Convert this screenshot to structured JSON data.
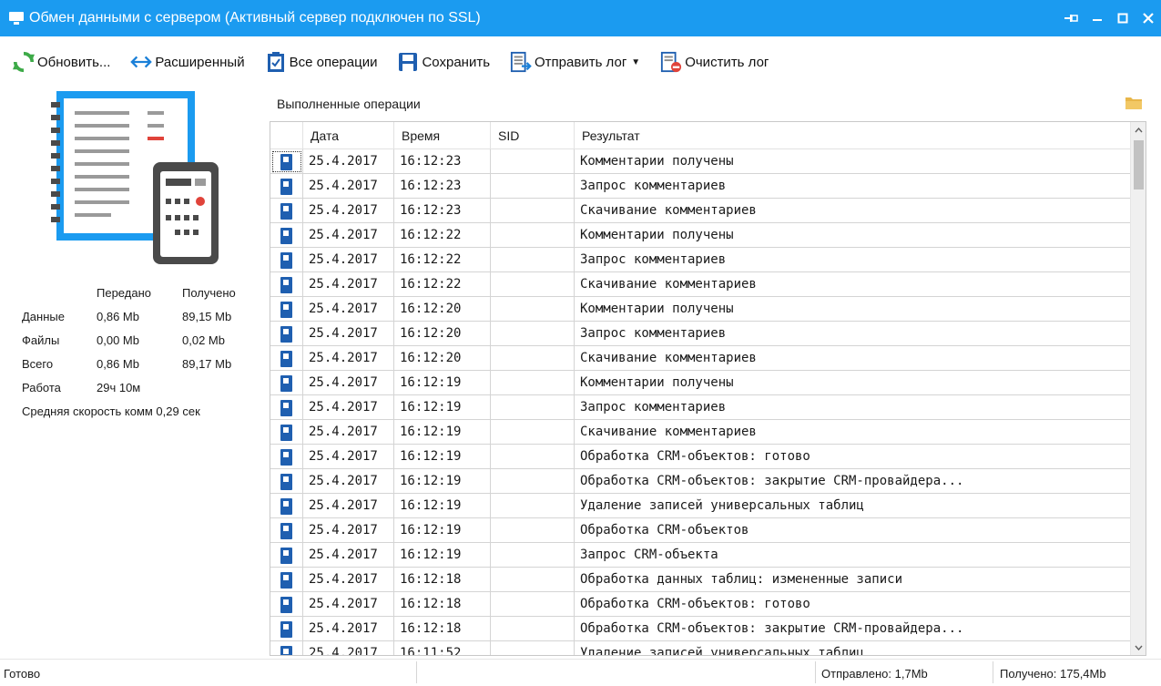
{
  "window": {
    "title": "Обмен данными с сервером (Активный сервер подключен по SSL)",
    "accent_color": "#1b9bf0"
  },
  "toolbar": {
    "refresh": {
      "label": "Обновить...",
      "icon": "refresh-icon"
    },
    "extended": {
      "label": "Расширенный",
      "icon": "double-arrow-icon"
    },
    "all_ops": {
      "label": "Все операции",
      "icon": "clipboard-check-icon"
    },
    "save": {
      "label": "Сохранить",
      "icon": "save-icon"
    },
    "send_log": {
      "label": "Отправить лог",
      "icon": "send-log-icon"
    },
    "clear_log": {
      "label": "Очистить лог",
      "icon": "clear-log-icon"
    }
  },
  "stats": {
    "header_sent": "Передано",
    "header_received": "Получено",
    "rows": [
      {
        "label": "Данные",
        "sent": "0,86 Mb",
        "received": "89,15 Mb"
      },
      {
        "label": "Файлы",
        "sent": "0,00 Mb",
        "received": "0,02 Mb"
      },
      {
        "label": "Всего",
        "sent": "0,86 Mb",
        "received": "89,17 Mb"
      },
      {
        "label": "Работа",
        "sent": "29ч 10м",
        "received": ""
      }
    ],
    "avg_speed": "Средняя скорость комм 0,29 сек"
  },
  "operations": {
    "section_title": "Выполненные операции",
    "columns": {
      "date": "Дата",
      "time": "Время",
      "sid": "SID",
      "result": "Результат"
    },
    "rows": [
      {
        "date": "25.4.2017",
        "time": "16:12:23",
        "sid": "",
        "result": "Комментарии получены"
      },
      {
        "date": "25.4.2017",
        "time": "16:12:23",
        "sid": "",
        "result": "Запрос комментариев"
      },
      {
        "date": "25.4.2017",
        "time": "16:12:23",
        "sid": "",
        "result": "Скачивание комментариев"
      },
      {
        "date": "25.4.2017",
        "time": "16:12:22",
        "sid": "",
        "result": "Комментарии получены"
      },
      {
        "date": "25.4.2017",
        "time": "16:12:22",
        "sid": "",
        "result": "Запрос комментариев"
      },
      {
        "date": "25.4.2017",
        "time": "16:12:22",
        "sid": "",
        "result": "Скачивание комментариев"
      },
      {
        "date": "25.4.2017",
        "time": "16:12:20",
        "sid": "",
        "result": "Комментарии получены"
      },
      {
        "date": "25.4.2017",
        "time": "16:12:20",
        "sid": "",
        "result": "Запрос комментариев"
      },
      {
        "date": "25.4.2017",
        "time": "16:12:20",
        "sid": "",
        "result": "Скачивание комментариев"
      },
      {
        "date": "25.4.2017",
        "time": "16:12:19",
        "sid": "",
        "result": "Комментарии получены"
      },
      {
        "date": "25.4.2017",
        "time": "16:12:19",
        "sid": "",
        "result": "Запрос комментариев"
      },
      {
        "date": "25.4.2017",
        "time": "16:12:19",
        "sid": "",
        "result": "Скачивание комментариев"
      },
      {
        "date": "25.4.2017",
        "time": "16:12:19",
        "sid": "",
        "result": "Обработка CRM-объектов: готово"
      },
      {
        "date": "25.4.2017",
        "time": "16:12:19",
        "sid": "",
        "result": "Обработка CRM-объектов: закрытие CRM-провайдера..."
      },
      {
        "date": "25.4.2017",
        "time": "16:12:19",
        "sid": "",
        "result": "Удаление записей универсальных таблиц"
      },
      {
        "date": "25.4.2017",
        "time": "16:12:19",
        "sid": "",
        "result": "Обработка CRM-объектов"
      },
      {
        "date": "25.4.2017",
        "time": "16:12:19",
        "sid": "",
        "result": "Запрос CRM-объекта"
      },
      {
        "date": "25.4.2017",
        "time": "16:12:18",
        "sid": "",
        "result": "Обработка данных таблиц: измененные записи"
      },
      {
        "date": "25.4.2017",
        "time": "16:12:18",
        "sid": "",
        "result": "Обработка CRM-объектов: готово"
      },
      {
        "date": "25.4.2017",
        "time": "16:12:18",
        "sid": "",
        "result": "Обработка CRM-объектов: закрытие CRM-провайдера..."
      },
      {
        "date": "25.4.2017",
        "time": "16:11:52",
        "sid": "",
        "result": "Удаление записей универсальных таблиц"
      }
    ]
  },
  "status": {
    "state": "Готово",
    "sent": "Отправлено: 1,7Mb",
    "received": "Получено: 175,4Mb"
  }
}
